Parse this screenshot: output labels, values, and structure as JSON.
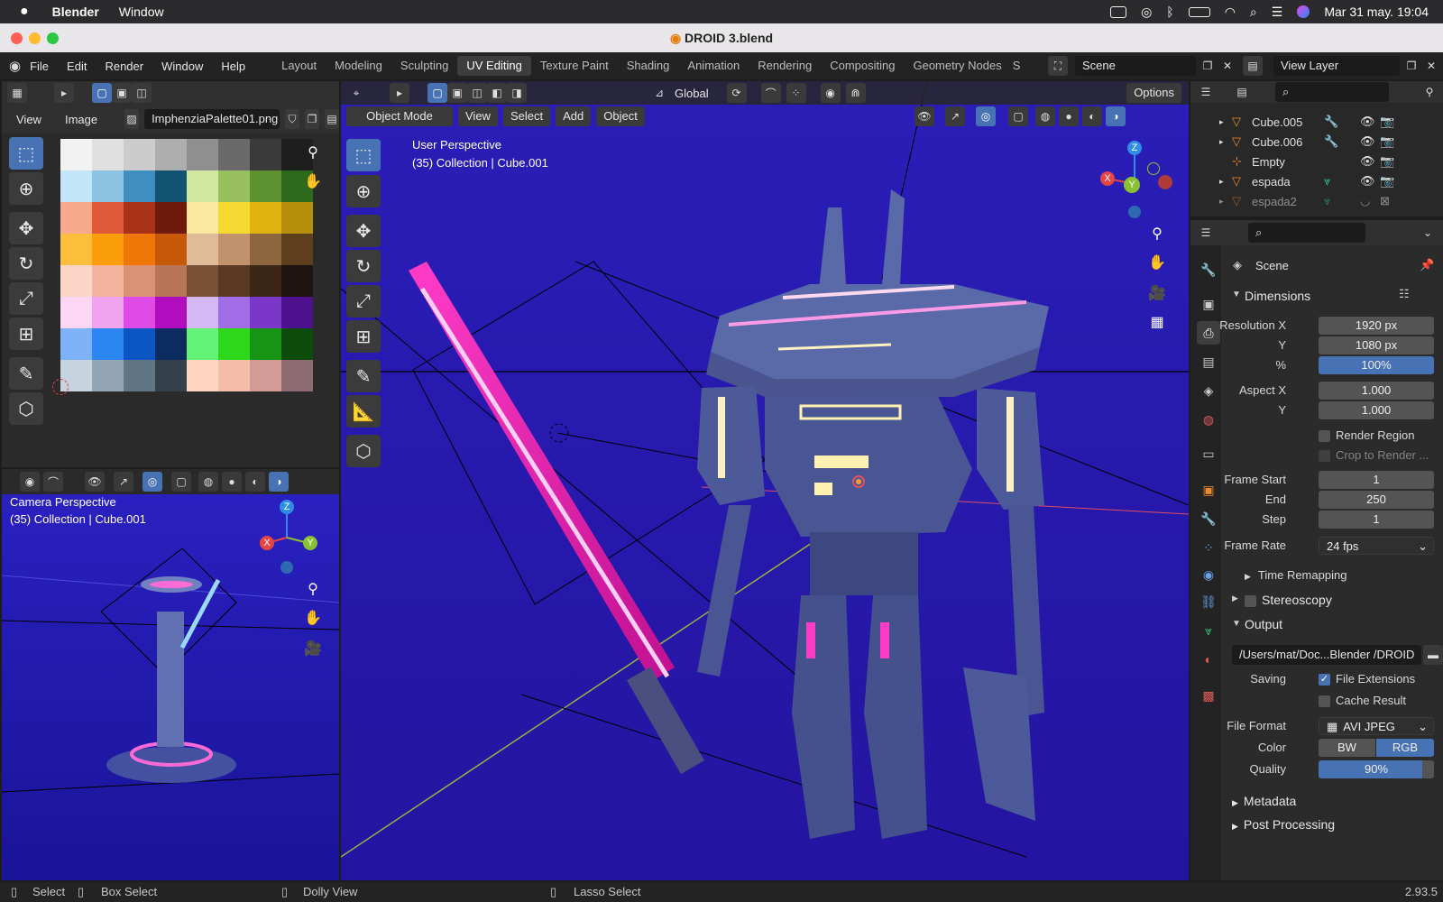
{
  "macos": {
    "app_name": "Blender",
    "menus": [
      "Window"
    ],
    "datetime": "Mar 31 may.  19:04"
  },
  "window": {
    "title": "DROID 3.blend"
  },
  "topbar": {
    "menus": [
      "File",
      "Edit",
      "Render",
      "Window",
      "Help"
    ],
    "workspaces": [
      "Layout",
      "Modeling",
      "Sculpting",
      "UV Editing",
      "Texture Paint",
      "Shading",
      "Animation",
      "Rendering",
      "Compositing",
      "Geometry Nodes",
      "S"
    ],
    "active_workspace": "UV Editing",
    "scene": "Scene",
    "view_layer": "View Layer"
  },
  "image_editor": {
    "menus": [
      "View",
      "Image"
    ],
    "image_name": "ImphenziaPalette01.png",
    "palette": [
      [
        "#f2f2f2",
        "#e0e0e0",
        "#cccccc",
        "#aeaeae",
        "#8f8f8f",
        "#6a6a6a",
        "#3a3a3a",
        "#1e1e1e"
      ],
      [
        "#c2e6f7",
        "#8dc4e3",
        "#3e8fbf",
        "#125273",
        "#d1e8a0",
        "#98c05f",
        "#5e9130",
        "#2e6a1c"
      ],
      [
        "#f9a98c",
        "#e05a3a",
        "#a83218",
        "#701a0d",
        "#fbe9a0",
        "#f6d930",
        "#e0b20d",
        "#b58f0a"
      ],
      [
        "#fdbe3c",
        "#fb9e0a",
        "#ee7707",
        "#c55907",
        "#dfbb97",
        "#c0936d",
        "#8d653f",
        "#5d3f1e"
      ],
      [
        "#fbd6c7",
        "#f2b49f",
        "#d99274",
        "#b97558",
        "#7a5034",
        "#5a3a24",
        "#3c2618",
        "#1f1510"
      ],
      [
        "#fbd6f5",
        "#f0a3ee",
        "#e04ae6",
        "#b00dbf",
        "#d4b8f5",
        "#a06de6",
        "#7b38c8",
        "#4d108f"
      ],
      [
        "#7eb2f7",
        "#2c86f2",
        "#0c56c3",
        "#0c2c60",
        "#64f276",
        "#2dd81a",
        "#169414",
        "#0c4d0c"
      ],
      [
        "#c7d3df",
        "#94a6b5",
        "#607684",
        "#34414a",
        "#fed5c0",
        "#f5bca9",
        "#d29b95",
        "#8e6a72"
      ]
    ]
  },
  "camera_view": {
    "perspective": "Camera Perspective",
    "collection": "(35) Collection | Cube.001",
    "axes": {
      "x": "X",
      "y": "Y",
      "z": "Z"
    }
  },
  "viewport": {
    "mode": "Object Mode",
    "menus": [
      "View",
      "Select",
      "Add",
      "Object"
    ],
    "orientation": "Global",
    "options_label": "Options",
    "perspective": "User Perspective",
    "collection": "(35) Collection | Cube.001",
    "axes": {
      "x": "X",
      "y": "Y",
      "z": "Z"
    }
  },
  "outliner": {
    "items": [
      {
        "name": "Cube.005"
      },
      {
        "name": "Cube.006"
      },
      {
        "name": "Empty"
      },
      {
        "name": "espada"
      },
      {
        "name": "espada2"
      }
    ]
  },
  "properties": {
    "context": "Scene",
    "dimensions": {
      "header": "Dimensions",
      "res_x_label": "Resolution X",
      "res_x": "1920 px",
      "res_y_label": "Y",
      "res_y": "1080 px",
      "pct_label": "%",
      "pct": "100%",
      "aspect_x_label": "Aspect X",
      "aspect_x": "1.000",
      "aspect_y_label": "Y",
      "aspect_y": "1.000",
      "render_region": "Render Region",
      "crop": "Crop to Render ...",
      "frame_start_label": "Frame Start",
      "frame_start": "1",
      "end_label": "End",
      "end": "250",
      "step_label": "Step",
      "step": "1",
      "frame_rate_label": "Frame Rate",
      "frame_rate": "24 fps",
      "time_remapping": "Time Remapping"
    },
    "stereoscopy": "Stereoscopy",
    "output": {
      "header": "Output",
      "path": "/Users/mat/Doc...Blender /DROID",
      "saving_label": "Saving",
      "file_extensions": "File Extensions",
      "cache_result": "Cache Result",
      "file_format_label": "File Format",
      "file_format": "AVI JPEG",
      "color_label": "Color",
      "color_bw": "BW",
      "color_rgb": "RGB",
      "quality_label": "Quality",
      "quality": "90%"
    },
    "metadata": "Metadata",
    "post_processing": "Post Processing"
  },
  "status": {
    "select": "Select",
    "box_select": "Box Select",
    "dolly_view": "Dolly View",
    "lasso_select": "Lasso Select",
    "version": "2.93.5"
  },
  "colors": {
    "accent": "#4772b3",
    "viewport_bg": "#2a20c0",
    "neon_pink": "#ff3cc8"
  }
}
